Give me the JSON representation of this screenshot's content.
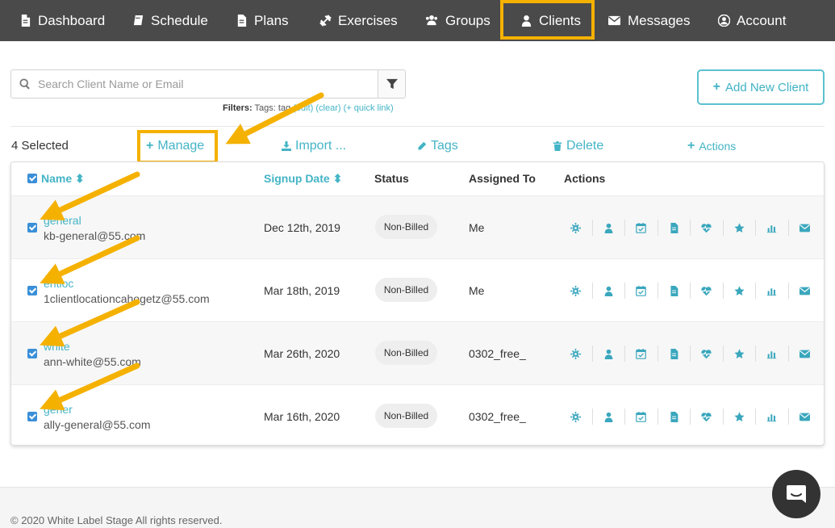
{
  "nav": {
    "items": [
      {
        "label": "Dashboard",
        "icon": "file-icon"
      },
      {
        "label": "Schedule",
        "icon": "book-icon"
      },
      {
        "label": "Plans",
        "icon": "document-icon"
      },
      {
        "label": "Exercises",
        "icon": "dumbbell-icon"
      },
      {
        "label": "Groups",
        "icon": "users-icon"
      },
      {
        "label": "Clients",
        "icon": "user-icon",
        "active": true
      },
      {
        "label": "Messages",
        "icon": "envelope-icon"
      },
      {
        "label": "Account",
        "icon": "user-circle-icon"
      }
    ]
  },
  "search": {
    "placeholder": "Search Client Name or Email",
    "value": ""
  },
  "filters": {
    "label": "Filters:",
    "text": "Tags: t",
    "obscured": "ag",
    "edit": "(edit)",
    "clear": "(clear)",
    "quick_link": "(+ quick link)"
  },
  "add_client_label": "Add New Client",
  "bulk": {
    "selected": "4 Selected",
    "manage": "Manage",
    "import": "Import ...",
    "tags": "Tags",
    "delete": "Delete",
    "actions": "Actions"
  },
  "table": {
    "headers": {
      "name": "Name",
      "signup": "Signup Date",
      "status": "Status",
      "assigned": "Assigned To",
      "actions": "Actions"
    },
    "rows": [
      {
        "name": "general",
        "email": "kb-general@55.com",
        "signup": "Dec 12th, 2019",
        "status": "Non-Billed",
        "assigned": "Me",
        "checked": true
      },
      {
        "name": "entloc",
        "email": "1clientlocationcahogetz@55.com",
        "signup": "Mar 18th, 2019",
        "status": "Non-Billed",
        "assigned": "Me",
        "checked": true
      },
      {
        "name": "white",
        "email": "ann-white@55.com",
        "signup": "Mar 26th, 2020",
        "status": "Non-Billed",
        "assigned": "0302_free_",
        "checked": true
      },
      {
        "name": "gener",
        "email": "ally-general@55.com",
        "signup": "Mar 16th, 2020",
        "status": "Non-Billed",
        "assigned": "0302_free_",
        "checked": true
      }
    ],
    "row_actions": [
      "gear-icon",
      "user-icon",
      "calendar-check-icon",
      "document-icon",
      "heartbeat-icon",
      "star-icon",
      "bar-chart-icon",
      "envelope-icon"
    ]
  },
  "footer": {
    "copyright": "© 2020 White Label Stage All rights reserved."
  },
  "colors": {
    "accent": "#44b4c6",
    "nav_bg": "#4a4a4a",
    "highlight": "#f5b100",
    "checkbox": "#3a8fd8"
  }
}
